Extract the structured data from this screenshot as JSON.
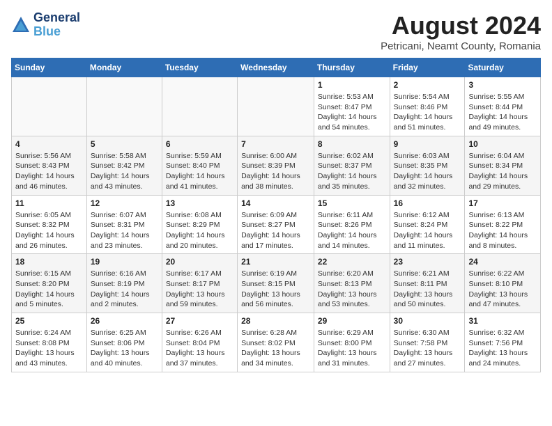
{
  "header": {
    "logo_line1": "General",
    "logo_line2": "Blue",
    "title": "August 2024",
    "subtitle": "Petricani, Neamt County, Romania"
  },
  "weekdays": [
    "Sunday",
    "Monday",
    "Tuesday",
    "Wednesday",
    "Thursday",
    "Friday",
    "Saturday"
  ],
  "weeks": [
    [
      {
        "day": "",
        "info": ""
      },
      {
        "day": "",
        "info": ""
      },
      {
        "day": "",
        "info": ""
      },
      {
        "day": "",
        "info": ""
      },
      {
        "day": "1",
        "info": "Sunrise: 5:53 AM\nSunset: 8:47 PM\nDaylight: 14 hours\nand 54 minutes."
      },
      {
        "day": "2",
        "info": "Sunrise: 5:54 AM\nSunset: 8:46 PM\nDaylight: 14 hours\nand 51 minutes."
      },
      {
        "day": "3",
        "info": "Sunrise: 5:55 AM\nSunset: 8:44 PM\nDaylight: 14 hours\nand 49 minutes."
      }
    ],
    [
      {
        "day": "4",
        "info": "Sunrise: 5:56 AM\nSunset: 8:43 PM\nDaylight: 14 hours\nand 46 minutes."
      },
      {
        "day": "5",
        "info": "Sunrise: 5:58 AM\nSunset: 8:42 PM\nDaylight: 14 hours\nand 43 minutes."
      },
      {
        "day": "6",
        "info": "Sunrise: 5:59 AM\nSunset: 8:40 PM\nDaylight: 14 hours\nand 41 minutes."
      },
      {
        "day": "7",
        "info": "Sunrise: 6:00 AM\nSunset: 8:39 PM\nDaylight: 14 hours\nand 38 minutes."
      },
      {
        "day": "8",
        "info": "Sunrise: 6:02 AM\nSunset: 8:37 PM\nDaylight: 14 hours\nand 35 minutes."
      },
      {
        "day": "9",
        "info": "Sunrise: 6:03 AM\nSunset: 8:35 PM\nDaylight: 14 hours\nand 32 minutes."
      },
      {
        "day": "10",
        "info": "Sunrise: 6:04 AM\nSunset: 8:34 PM\nDaylight: 14 hours\nand 29 minutes."
      }
    ],
    [
      {
        "day": "11",
        "info": "Sunrise: 6:05 AM\nSunset: 8:32 PM\nDaylight: 14 hours\nand 26 minutes."
      },
      {
        "day": "12",
        "info": "Sunrise: 6:07 AM\nSunset: 8:31 PM\nDaylight: 14 hours\nand 23 minutes."
      },
      {
        "day": "13",
        "info": "Sunrise: 6:08 AM\nSunset: 8:29 PM\nDaylight: 14 hours\nand 20 minutes."
      },
      {
        "day": "14",
        "info": "Sunrise: 6:09 AM\nSunset: 8:27 PM\nDaylight: 14 hours\nand 17 minutes."
      },
      {
        "day": "15",
        "info": "Sunrise: 6:11 AM\nSunset: 8:26 PM\nDaylight: 14 hours\nand 14 minutes."
      },
      {
        "day": "16",
        "info": "Sunrise: 6:12 AM\nSunset: 8:24 PM\nDaylight: 14 hours\nand 11 minutes."
      },
      {
        "day": "17",
        "info": "Sunrise: 6:13 AM\nSunset: 8:22 PM\nDaylight: 14 hours\nand 8 minutes."
      }
    ],
    [
      {
        "day": "18",
        "info": "Sunrise: 6:15 AM\nSunset: 8:20 PM\nDaylight: 14 hours\nand 5 minutes."
      },
      {
        "day": "19",
        "info": "Sunrise: 6:16 AM\nSunset: 8:19 PM\nDaylight: 14 hours\nand 2 minutes."
      },
      {
        "day": "20",
        "info": "Sunrise: 6:17 AM\nSunset: 8:17 PM\nDaylight: 13 hours\nand 59 minutes."
      },
      {
        "day": "21",
        "info": "Sunrise: 6:19 AM\nSunset: 8:15 PM\nDaylight: 13 hours\nand 56 minutes."
      },
      {
        "day": "22",
        "info": "Sunrise: 6:20 AM\nSunset: 8:13 PM\nDaylight: 13 hours\nand 53 minutes."
      },
      {
        "day": "23",
        "info": "Sunrise: 6:21 AM\nSunset: 8:11 PM\nDaylight: 13 hours\nand 50 minutes."
      },
      {
        "day": "24",
        "info": "Sunrise: 6:22 AM\nSunset: 8:10 PM\nDaylight: 13 hours\nand 47 minutes."
      }
    ],
    [
      {
        "day": "25",
        "info": "Sunrise: 6:24 AM\nSunset: 8:08 PM\nDaylight: 13 hours\nand 43 minutes."
      },
      {
        "day": "26",
        "info": "Sunrise: 6:25 AM\nSunset: 8:06 PM\nDaylight: 13 hours\nand 40 minutes."
      },
      {
        "day": "27",
        "info": "Sunrise: 6:26 AM\nSunset: 8:04 PM\nDaylight: 13 hours\nand 37 minutes."
      },
      {
        "day": "28",
        "info": "Sunrise: 6:28 AM\nSunset: 8:02 PM\nDaylight: 13 hours\nand 34 minutes."
      },
      {
        "day": "29",
        "info": "Sunrise: 6:29 AM\nSunset: 8:00 PM\nDaylight: 13 hours\nand 31 minutes."
      },
      {
        "day": "30",
        "info": "Sunrise: 6:30 AM\nSunset: 7:58 PM\nDaylight: 13 hours\nand 27 minutes."
      },
      {
        "day": "31",
        "info": "Sunrise: 6:32 AM\nSunset: 7:56 PM\nDaylight: 13 hours\nand 24 minutes."
      }
    ]
  ]
}
